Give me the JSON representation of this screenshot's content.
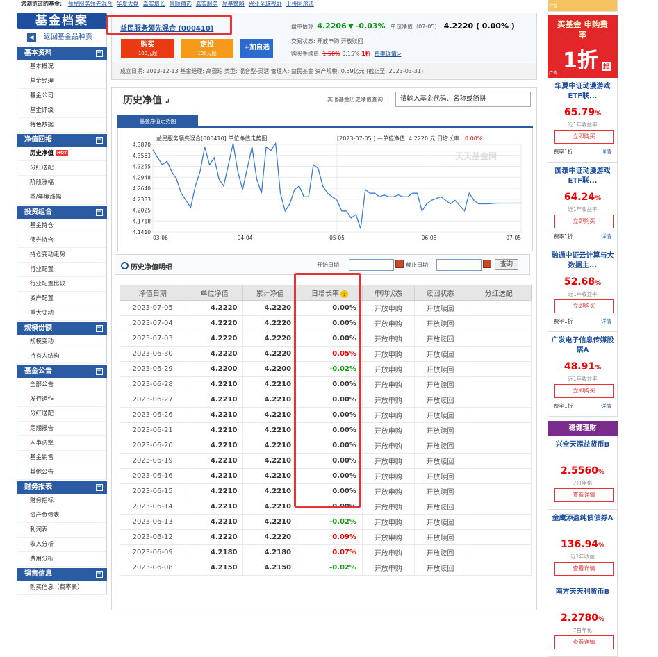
{
  "topbar": {
    "label": "您浏览过的基金:",
    "links": [
      "益民服务领先混合",
      "华夏大盘",
      "嘉实增长",
      "景顺精选",
      "嘉实服务",
      "易基策略",
      "兴业全球视野",
      "上投阿尔法"
    ]
  },
  "left": {
    "logo": "基金档案",
    "back": "返回基金品种页",
    "sections": [
      {
        "title": "基本资料",
        "items": [
          "基本概况",
          "基金经理",
          "基金公司",
          "基金评级",
          "特色数据"
        ]
      },
      {
        "title": "净值回报",
        "items": [
          "历史净值",
          "分红送配",
          "阶段涨幅",
          "季/年度涨幅"
        ]
      },
      {
        "title": "投资组合",
        "items": [
          "基金持仓",
          "债券持仓",
          "持仓变动走势",
          "行业配置",
          "行业配置比较",
          "资产配置",
          "重大变动"
        ]
      },
      {
        "title": "规模份额",
        "items": [
          "规模变动",
          "持有人结构"
        ]
      },
      {
        "title": "基金公告",
        "items": [
          "全部公告",
          "发行运作",
          "分红送配",
          "定期报告",
          "人事调整",
          "基金销售",
          "其他公告"
        ]
      },
      {
        "title": "财务报表",
        "items": [
          "财务指标",
          "资产负债表",
          "利润表",
          "收入分析",
          "费用分析"
        ]
      },
      {
        "title": "销售信息",
        "items": [
          "购买信息（费率表）"
        ]
      }
    ],
    "hot": "HOT"
  },
  "header": {
    "fund_name": "益民服务领先混合 (000410)",
    "buy": "购买",
    "buy_sub": "100元起",
    "fixed": "定投",
    "fixed_sub": "100元起",
    "watch": "+加自选",
    "est_label": "盘中估算:",
    "est_value": "4.2206",
    "est_change": "-0.03%",
    "nav_label": "单位净值（07-05）:",
    "nav_value": "4.2220 ( 0.00% )",
    "trade_status": "交易状态:  开放申购    开放赎回",
    "fee_label": "购买手续费:",
    "fee_old": "1.50%",
    "fee_new": "0.15%",
    "fee_discount": "1折",
    "fee_link": "费率详情>"
  },
  "info": "成立日期: 2013-12-13    基金经理:  高蕴珀    类型: 混合型-灵活    管理人: 益民基金    资产规模:  0.59亿元  (截止至: 2023-03-31)",
  "history": {
    "title": "历史净值",
    "other_label": "其他基金历史净值查询:",
    "search_value": "请输入基金代码、名称或简拼",
    "tab": "基金净值走势图",
    "detail_title": "历史净值明细",
    "start_label": "开始日期:",
    "end_label": "截止日期:",
    "query": "查询",
    "headers": [
      "净值日期",
      "单位净值",
      "累计净值",
      "日增长率",
      "申购状态",
      "赎回状态",
      "分红送配"
    ],
    "rows": [
      [
        "2023-07-05",
        "4.2220",
        "4.2220",
        "0.00%",
        "开放申购",
        "开放赎回",
        ""
      ],
      [
        "2023-07-04",
        "4.2220",
        "4.2220",
        "0.00%",
        "开放申购",
        "开放赎回",
        ""
      ],
      [
        "2023-07-03",
        "4.2220",
        "4.2220",
        "0.00%",
        "开放申购",
        "开放赎回",
        ""
      ],
      [
        "2023-06-30",
        "4.2220",
        "4.2220",
        "0.05%",
        "开放申购",
        "开放赎回",
        ""
      ],
      [
        "2023-06-29",
        "4.2200",
        "4.2200",
        "-0.02%",
        "开放申购",
        "开放赎回",
        ""
      ],
      [
        "2023-06-28",
        "4.2210",
        "4.2210",
        "0.00%",
        "开放申购",
        "开放赎回",
        ""
      ],
      [
        "2023-06-27",
        "4.2210",
        "4.2210",
        "0.00%",
        "开放申购",
        "开放赎回",
        ""
      ],
      [
        "2023-06-26",
        "4.2210",
        "4.2210",
        "0.00%",
        "开放申购",
        "开放赎回",
        ""
      ],
      [
        "2023-06-21",
        "4.2210",
        "4.2210",
        "0.00%",
        "开放申购",
        "开放赎回",
        ""
      ],
      [
        "2023-06-20",
        "4.2210",
        "4.2210",
        "0.00%",
        "开放申购",
        "开放赎回",
        ""
      ],
      [
        "2023-06-19",
        "4.2210",
        "4.2210",
        "0.00%",
        "开放申购",
        "开放赎回",
        ""
      ],
      [
        "2023-06-16",
        "4.2210",
        "4.2210",
        "0.00%",
        "开放申购",
        "开放赎回",
        ""
      ],
      [
        "2023-06-15",
        "4.2210",
        "4.2210",
        "0.00%",
        "开放申购",
        "开放赎回",
        ""
      ],
      [
        "2023-06-14",
        "4.2210",
        "4.2210",
        "0.00%",
        "开放申购",
        "开放赎回",
        ""
      ],
      [
        "2023-06-13",
        "4.2210",
        "4.2210",
        "-0.02%",
        "开放申购",
        "开放赎回",
        ""
      ],
      [
        "2023-06-12",
        "4.2220",
        "4.2220",
        "0.09%",
        "开放申购",
        "开放赎回",
        ""
      ],
      [
        "2023-06-09",
        "4.2180",
        "4.2180",
        "0.07%",
        "开放申购",
        "开放赎回",
        ""
      ],
      [
        "2023-06-08",
        "4.2150",
        "4.2150",
        "-0.02%",
        "开放申购",
        "开放赎回",
        ""
      ]
    ]
  },
  "chart_data": {
    "type": "line",
    "title": "益民服务领先混合[000410] 单位净值走势图",
    "info": "[2023-07-05 ]  —单位净值: 4.2220 元  日增长率:",
    "info_rate": "0.00%",
    "watermark": "天天基金网",
    "xticks": [
      "03-06",
      "04-04",
      "05-05",
      "06-08",
      "07-05"
    ],
    "yticks": [
      "4.3870",
      "4.3563",
      "4.3255",
      "4.2948",
      "4.2640",
      "4.2333",
      "4.2025",
      "4.1718",
      "4.1410"
    ],
    "ylim": [
      4.141,
      4.387
    ],
    "series": [
      {
        "values": [
          4.372,
          4.35,
          4.33,
          4.34,
          4.31,
          4.29,
          4.25,
          4.23,
          4.21,
          4.27,
          4.31,
          4.38,
          4.33,
          4.35,
          4.29,
          4.27,
          4.33,
          4.39,
          4.31,
          4.26,
          4.32,
          4.38,
          4.29,
          4.25,
          4.38,
          4.37,
          4.39,
          4.25,
          4.2,
          4.22,
          4.26,
          4.27,
          4.24,
          4.24,
          4.33,
          4.32,
          4.27,
          4.25,
          4.24,
          4.23,
          4.2,
          4.2,
          4.18,
          4.19,
          4.15,
          4.26,
          4.25,
          4.25,
          4.24,
          4.245,
          4.24,
          4.24,
          4.245,
          4.24,
          4.24,
          4.25,
          4.25,
          4.2,
          4.22,
          4.23,
          4.235,
          4.24,
          4.23,
          4.22,
          4.23,
          4.215,
          4.2,
          4.25,
          4.23,
          4.22,
          4.22,
          4.22,
          4.221,
          4.222,
          4.222,
          4.222,
          4.222,
          4.222,
          4.222
        ]
      }
    ]
  },
  "right": {
    "ad_title": "买基金 申购费率",
    "ad_big": "1折",
    "ad_tag": "起",
    "ad_small": "广告",
    "buy_label": "立即购买",
    "fee_label": "费率1折",
    "detail_label": "详情",
    "wallet_title": "稳健理财",
    "view_label": "查看详情",
    "cards": [
      {
        "name": "华夏中证动漫游戏ETF联...",
        "pct": "65.79",
        "unit": "%",
        "lb": "近1年收益率"
      },
      {
        "name": "国泰中证动漫游戏ETF联...",
        "pct": "64.24",
        "unit": "%",
        "lb": "近1年收益率"
      },
      {
        "name": "融通中证云计算与大数据主...",
        "pct": "52.68",
        "unit": "%",
        "lb": "近1年收益率"
      },
      {
        "name": "广发电子信息传媒股票A",
        "pct": "48.91",
        "unit": "%",
        "lb": "近1年收益率"
      }
    ],
    "wcards": [
      {
        "name": "兴全天添益货币B",
        "pct": "2.5560",
        "unit": "%",
        "lb": "7日年化"
      },
      {
        "name": "金鹰添盈纯债债券A",
        "pct": "136.94",
        "unit": "%",
        "lb": "近1年收益"
      },
      {
        "name": "南方天天利货币B",
        "pct": "2.2780",
        "unit": "%",
        "lb": "7日年化"
      }
    ]
  },
  "colors": {
    "brand": "#1d4f9e",
    "up": "#e00000",
    "down": "#119911",
    "accent": "#e3262a"
  }
}
